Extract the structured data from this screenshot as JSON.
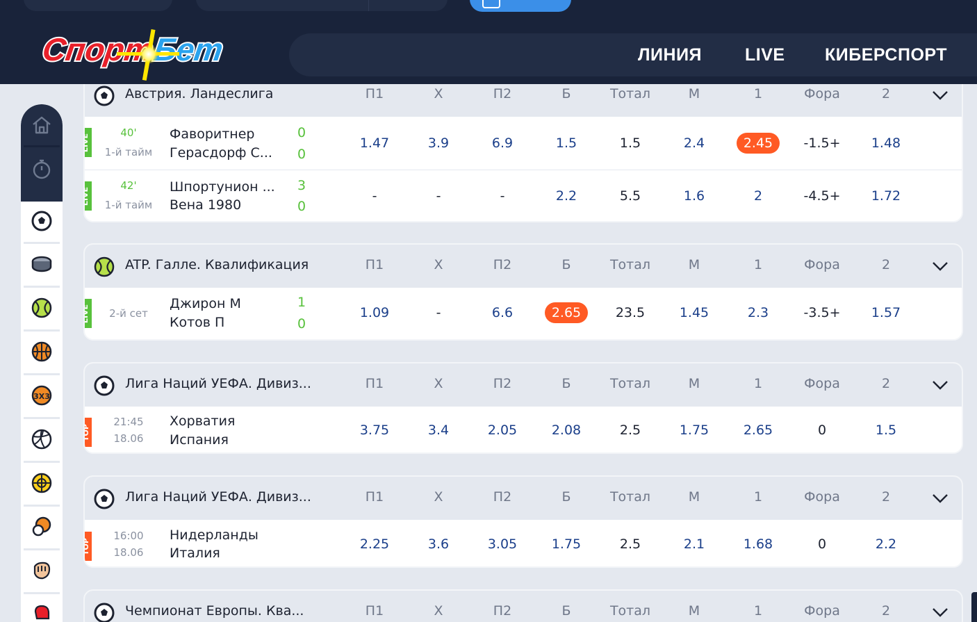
{
  "header": {
    "logo_text": "Спорт Бет",
    "nav": [
      "ЛИНИЯ",
      "LIVE",
      "КИБЕРСПОРТ"
    ]
  },
  "sidebar": {
    "icons": [
      "home-icon",
      "timer-icon",
      "football-icon",
      "hockey-icon",
      "tennis-icon",
      "basketball-icon",
      "basketball-3x3-icon",
      "volleyball-icon",
      "handball-icon",
      "table-tennis-icon",
      "mma-icon",
      "boxing-icon"
    ]
  },
  "columns": [
    "П1",
    "X",
    "П2",
    "Б",
    "Тотал",
    "М",
    "1",
    "Фора",
    "2"
  ],
  "colors": {
    "accent": "#ff5a24",
    "live": "#58c13c",
    "odd_blue": "#1b3f8a",
    "header_bg": "#19233a"
  },
  "cards": [
    {
      "sport": "football-icon",
      "league": "Австрия. Ландеслига",
      "events": [
        {
          "tag": "LIVE",
          "time": "40'",
          "period": "1-й тайм",
          "team1": "Фаворитнер",
          "team2": "Герасдорф С...",
          "score1": "0",
          "score2": "0",
          "odds": [
            "1.47",
            "3.9",
            "6.9",
            "1.5",
            "1.5",
            "2.4",
            "2.45",
            "-1.5+",
            "1.48"
          ],
          "highlight": 6
        },
        {
          "tag": "LIVE",
          "time": "42'",
          "period": "1-й тайм",
          "team1": "Шпортунион ...",
          "team2": "Вена 1980",
          "score1": "3",
          "score2": "0",
          "odds": [
            "-",
            "-",
            "-",
            "2.2",
            "5.5",
            "1.6",
            "2",
            "-4.5+",
            "1.72"
          ],
          "highlight": -1
        }
      ]
    },
    {
      "sport": "tennis-icon",
      "league": "ATP. Галле. Квалификация",
      "events": [
        {
          "tag": "LIVE",
          "time": "",
          "period": "2-й сет",
          "team1": "Джирон М",
          "team2": "Котов П",
          "score1": "1",
          "score2": "0",
          "odds": [
            "1.09",
            "-",
            "6.6",
            "2.65",
            "23.5",
            "1.45",
            "2.3",
            "-3.5+",
            "1.57"
          ],
          "highlight": 3
        }
      ]
    },
    {
      "sport": "football-icon",
      "league": "Лига Наций УЕФА. Дивиз...",
      "events": [
        {
          "tag": "TOP",
          "time": "21:45",
          "period": "18.06",
          "team1": "Хорватия",
          "team2": "Испания",
          "score1": "",
          "score2": "",
          "odds": [
            "3.75",
            "3.4",
            "2.05",
            "2.08",
            "2.5",
            "1.75",
            "2.65",
            "0",
            "1.5"
          ],
          "highlight": -1
        }
      ]
    },
    {
      "sport": "football-icon",
      "league": "Лига Наций УЕФА. Дивиз...",
      "events": [
        {
          "tag": "TOP",
          "time": "16:00",
          "period": "18.06",
          "team1": "Нидерланды",
          "team2": "Италия",
          "score1": "",
          "score2": "",
          "odds": [
            "2.25",
            "3.6",
            "3.05",
            "1.75",
            "2.5",
            "2.1",
            "1.68",
            "0",
            "2.2"
          ],
          "highlight": -1
        }
      ]
    },
    {
      "sport": "football-icon",
      "league": "Чемпионат Европы. Ква...",
      "events": []
    }
  ]
}
